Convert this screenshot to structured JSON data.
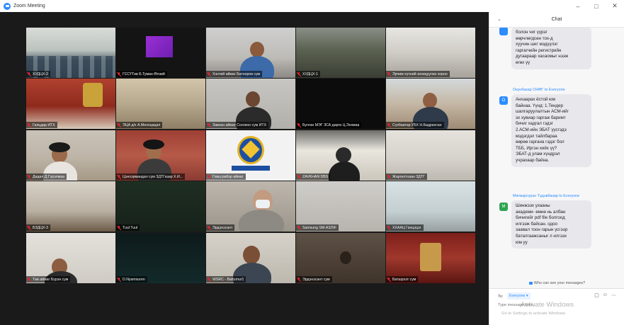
{
  "window": {
    "title": "Zoom Meeting",
    "controls": [
      "–",
      "□",
      "✕"
    ]
  },
  "participants": [
    {
      "name": "ХУДЦХ-2",
      "scene": "classroom"
    },
    {
      "name": "ГССҮТөв Б.Туман-Өлзий",
      "scene": "purple"
    },
    {
      "name": "Хэнтий аймаг Батноров сум",
      "scene": "man-office"
    },
    {
      "name": "ХУДЦХ-1",
      "scene": "meeting-room"
    },
    {
      "name": "Эрчим хүчний зохицуулах хороо",
      "scene": "office-lights"
    },
    {
      "name": "Гальдар ИТХ",
      "scene": "red-banner"
    },
    {
      "name": "ЭЦА д/х А.Менхцацал",
      "scene": "blurry-room"
    },
    {
      "name": "Завхан аймаг Сонгино сум ИТХ",
      "scene": "man-whitewall"
    },
    {
      "name": "Булган МЭГ ЗСА дарга Ц.Энхмаа",
      "scene": "dark"
    },
    {
      "name": "Сүхбаатар УБХ Н.Бадрахсан",
      "scene": "man-window"
    },
    {
      "name": "Дадал Д.Гэрэлмаа",
      "scene": "woman-office"
    },
    {
      "name": "Цэнхэрмандал сум ЗДТГазар Х.И...",
      "scene": "woman-blanket"
    },
    {
      "name": "Говьсүмбэр аймаг",
      "scene": "emblem"
    },
    {
      "name": "ZAVKHAN DBS",
      "scene": "man-phone"
    },
    {
      "name": "Жаргалтхаан ЗДТГ",
      "scene": "empty-room"
    },
    {
      "name": "БЗДЦХ-3",
      "scene": "classroom-empty"
    },
    {
      "name": "Tuul Tuul",
      "scene": "dark-green"
    },
    {
      "name": "Эрдэнэсант",
      "scene": "woman-mask"
    },
    {
      "name": "Samsung SM-A325F",
      "scene": "ceiling"
    },
    {
      "name": "ХХААЦ Ганцэцэг",
      "scene": "office-plant"
    },
    {
      "name": "Төв аймаг Бүрэн сум",
      "scene": "woman-partial"
    },
    {
      "name": "D.Nyamsuren",
      "scene": "dark-teal"
    },
    {
      "name": "WSRC - Battumur1",
      "scene": "man-glasses"
    },
    {
      "name": "Эрдэнэсант сум",
      "scene": "man-dim"
    },
    {
      "name": "Батшрээт сум",
      "scene": "red-room"
    }
  ],
  "chat": {
    "title": "Chat",
    "messages": [
      {
        "sender": "",
        "avatar_letter": "",
        "avatar_color": "#2d8cff",
        "lines": [
          "болон чиг үүрэг",
          "өөрчлөгдсөн тох-д",
          "хуучин шиг мэдүүлэг",
          "гаргагчийн регистрийн",
          "дугаараар хасаомыг нээж",
          "өгөх үү"
        ]
      },
      {
        "sender": "Окунбазар ОНӨГ to Everyone",
        "avatar_letter": "О",
        "avatar_color": "#2d8cff",
        "lines": [
          "Анхаарах ёстой юм",
          "байнаа. Үүнд: 1.Тендер",
          "шалгаруулалтын АСМ-ийг",
          "эх хувиар гаргаж баримт",
          "бичиг хадгал гэдэг",
          "2.АСМ-ийн ЭБАТ үүсгэдэ",
          "мэдэгдэл тайлбараа",
          "өөрөө гаргана гэдэг бол",
          "ТББ, Иргэн хийх үү?",
          "ЭБАТ-д улам хүндрэл",
          "учрахаар байна."
        ]
      },
      {
        "sender": "Мягмарсүрэн Түдэвбазар to Everyone",
        "avatar_letter": "M",
        "avatar_color": "#2ea44f",
        "lines": [
          "Шинжээх ухааны",
          "академи- өмнө нь албан",
          "бичигийг pdf file  болгоод",
          "илгээж байсан. одоо",
          "заавал тоон гарын үсгээр",
          "баталгаажсаныг л илгээх",
          "юм уу"
        ]
      }
    ],
    "who_can_see": "Who can see your messages?",
    "to_label": "To:",
    "to_value": "Everyone ▾",
    "input_placeholder": "Type message here...",
    "watermark_title": "Activate Windows",
    "watermark_sub": "Go to Settings to activate Windows."
  }
}
